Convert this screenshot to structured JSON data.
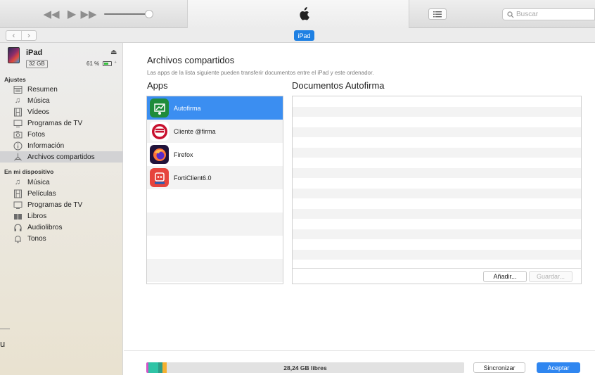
{
  "toolbar": {
    "search_placeholder": "Buscar",
    "device_pill": "iPad"
  },
  "device": {
    "name": "iPad",
    "capacity": "32 GB",
    "battery": "61 %",
    "battery_level": 0.61
  },
  "sidebar": {
    "section_settings": "Ajustes",
    "settings_items": [
      {
        "label": "Resumen",
        "icon": "summary-icon"
      },
      {
        "label": "Música",
        "icon": "music-note-icon"
      },
      {
        "label": "Vídeos",
        "icon": "film-icon"
      },
      {
        "label": "Programas de TV",
        "icon": "tv-icon"
      },
      {
        "label": "Fotos",
        "icon": "camera-icon"
      },
      {
        "label": "Información",
        "icon": "info-icon"
      },
      {
        "label": "Archivos compartidos",
        "icon": "apps-icon",
        "selected": true
      }
    ],
    "section_device": "En mi dispositivo",
    "device_items": [
      {
        "label": "Música",
        "icon": "music-note-icon"
      },
      {
        "label": "Películas",
        "icon": "film-icon"
      },
      {
        "label": "Programas de TV",
        "icon": "tv-icon"
      },
      {
        "label": "Libros",
        "icon": "books-icon"
      },
      {
        "label": "Audiolibros",
        "icon": "headphones-icon"
      },
      {
        "label": "Tonos",
        "icon": "bell-icon"
      }
    ],
    "cutoff_char": "u"
  },
  "main": {
    "title": "Archivos compartidos",
    "description": "Las apps de la lista siguiente pueden transferir documentos entre el iPad y este ordenador.",
    "apps_title": "Apps",
    "docs_title": "Documentos Autofirma",
    "apps": [
      {
        "name": "Autofirma",
        "icon": "autofirma-icon",
        "selected": true
      },
      {
        "name": "Cliente @firma",
        "icon": "cliente-firma-icon"
      },
      {
        "name": "Firefox",
        "icon": "firefox-icon"
      },
      {
        "name": "FortiClient6.0",
        "icon": "forticlient-icon"
      }
    ],
    "add_button": "Añadir...",
    "save_button": "Guardar..."
  },
  "bottom": {
    "storage_label": "28,24 GB libres",
    "sync_button": "Sincronizar",
    "accept_button": "Aceptar",
    "storage_colors": [
      "#d653c8",
      "#2fc4a6",
      "#2e9e88",
      "#f5b030",
      "#e2e2e2"
    ]
  }
}
